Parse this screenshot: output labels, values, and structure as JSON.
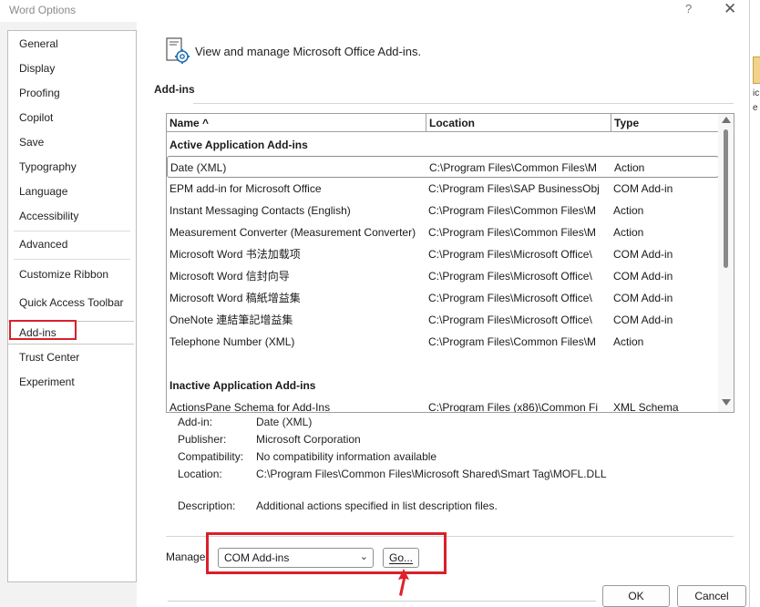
{
  "window": {
    "title": "Word Options",
    "help_glyph": "?",
    "close_glyph": "✕"
  },
  "background_app": {
    "text1": "ic",
    "text2": "e"
  },
  "nav": {
    "items": [
      {
        "label": "General"
      },
      {
        "label": "Display"
      },
      {
        "label": "Proofing"
      },
      {
        "label": "Copilot"
      },
      {
        "label": "Save"
      },
      {
        "label": "Typography"
      },
      {
        "label": "Language"
      },
      {
        "label": "Accessibility"
      },
      {
        "label": "Advanced"
      },
      {
        "label": "Customize Ribbon"
      },
      {
        "label": "Quick Access Toolbar"
      },
      {
        "label": "Add-ins"
      },
      {
        "label": "Trust Center"
      },
      {
        "label": "Experiment"
      }
    ],
    "selected": "Add-ins"
  },
  "header": {
    "text": "View and manage Microsoft Office Add-ins.",
    "icon": "addins-gear-icon"
  },
  "section": {
    "title": "Add-ins"
  },
  "table": {
    "columns": [
      "Name ^",
      "Location",
      "Type"
    ],
    "groups": [
      {
        "title": "Active Application Add-ins",
        "rows": [
          {
            "name": "Date (XML)",
            "location": "C:\\Program Files\\Common Files\\M",
            "type": "Action"
          },
          {
            "name": "EPM add-in for Microsoft Office",
            "location": "C:\\Program Files\\SAP BusinessObj",
            "type": "COM Add-in"
          },
          {
            "name": "Instant Messaging Contacts (English)",
            "location": "C:\\Program Files\\Common Files\\M",
            "type": "Action"
          },
          {
            "name": "Measurement Converter (Measurement Converter)",
            "location": "C:\\Program Files\\Common Files\\M",
            "type": "Action"
          },
          {
            "name": "Microsoft Word 书法加载项",
            "location": "C:\\Program Files\\Microsoft Office\\",
            "type": "COM Add-in"
          },
          {
            "name": "Microsoft Word 信封向导",
            "location": "C:\\Program Files\\Microsoft Office\\",
            "type": "COM Add-in"
          },
          {
            "name": "Microsoft Word 稿紙增益集",
            "location": "C:\\Program Files\\Microsoft Office\\",
            "type": "COM Add-in"
          },
          {
            "name": "OneNote 連結筆記增益集",
            "location": "C:\\Program Files\\Microsoft Office\\",
            "type": "COM Add-in"
          },
          {
            "name": "Telephone Number (XML)",
            "location": "C:\\Program Files\\Common Files\\M",
            "type": "Action"
          }
        ]
      },
      {
        "title": "Inactive Application Add-ins",
        "rows": [
          {
            "name": "ActionsPane Schema for Add-Ins",
            "location": "C:\\Program Files (x86)\\Common Fi",
            "type": "XML Schema"
          }
        ]
      }
    ]
  },
  "details": {
    "addin_label": "Add-in:",
    "addin_value": "Date (XML)",
    "publisher_label": "Publisher:",
    "publisher_value": "Microsoft Corporation",
    "compat_label": "Compatibility:",
    "compat_value": "No compatibility information available",
    "location_label": "Location:",
    "location_value": "C:\\Program Files\\Common Files\\Microsoft Shared\\Smart Tag\\MOFL.DLL",
    "description_label": "Description:",
    "description_value": "Additional actions specified in list description files."
  },
  "manage": {
    "label": "Manage:",
    "selected": "COM Add-ins",
    "go_label": "Go..."
  },
  "footer": {
    "ok_label": "OK",
    "cancel_label": "Cancel"
  },
  "colors": {
    "highlight_red": "#d9202a"
  }
}
